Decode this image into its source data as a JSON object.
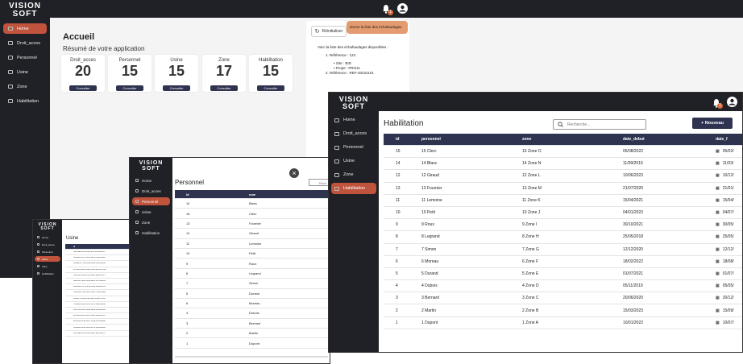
{
  "logo": {
    "line1": "VISION",
    "line2": "SOFT"
  },
  "nav": [
    "Home",
    "Droit_acces",
    "Personnel",
    "Usine",
    "Zone",
    "Habilitation"
  ],
  "accueil": {
    "title": "Accueil",
    "subtitle": "Résumé de votre application",
    "cards": [
      {
        "label": "Droit_acces",
        "value": "20",
        "button": "Consulter"
      },
      {
        "label": "Personnel",
        "value": "15",
        "button": "Consulter"
      },
      {
        "label": "Usine",
        "value": "15",
        "button": "Consulter"
      },
      {
        "label": "Zone",
        "value": "17",
        "button": "Consulter"
      },
      {
        "label": "Habilitation",
        "value": "15",
        "button": "Consulter"
      }
    ],
    "notif_count": "1",
    "reset_label": "Réinitialiser",
    "chip_label": "donne la liste des échafaudages",
    "reply_intro": "Voici la liste des échafaudages disponibles :",
    "reply_item1": "1. Référence : 123",
    "reply_site": "• Site : BID",
    "reply_projet": "• Projet : PROJ1",
    "reply_item2": "2. Référence : REF-20231101"
  },
  "habilitation": {
    "title": "Habilitation",
    "search_placeholder": "Recherche...",
    "new_button": "+ Nouveau",
    "notif_count": "1",
    "columns": [
      "id",
      "personnel",
      "zone",
      "date_debut",
      "date_f"
    ],
    "rows": [
      [
        "15",
        "15 Clerc",
        "15 Zone O",
        "05/08/2022",
        "05/02/"
      ],
      [
        "14",
        "14 Blanc",
        "14 Zone N",
        "11/09/2019",
        "11/03/"
      ],
      [
        "12",
        "12 Giraud",
        "12 Zone L",
        "10/06/2023",
        "10/12/"
      ],
      [
        "13",
        "13 Fournier",
        "13 Zone M",
        "21/07/2020",
        "21/01/"
      ],
      [
        "11",
        "11 Lemoine",
        "11 Zone K",
        "15/04/2021",
        "15/04/"
      ],
      [
        "10",
        "10 Petit",
        "10 Zone J",
        "04/01/2023",
        "04/07/"
      ],
      [
        "9",
        "9 Roux",
        "9 Zone I",
        "30/10/2021",
        "30/05/"
      ],
      [
        "8",
        "8 Legrand",
        "8 Zone H",
        "25/05/2018",
        "25/05/"
      ],
      [
        "7",
        "7 Simon",
        "7 Zone G",
        "12/12/2020",
        "12/12/"
      ],
      [
        "6",
        "6 Moreau",
        "6 Zone F",
        "18/02/2022",
        "18/08/"
      ],
      [
        "5",
        "5 Durand",
        "5 Zone E",
        "01/07/2021",
        "01/07/"
      ],
      [
        "4",
        "4 Dubois",
        "4 Zone D",
        "05/11/2019",
        "05/05/"
      ],
      [
        "3",
        "3 Bernard",
        "3 Zone C",
        "20/06/2020",
        "20/12/"
      ],
      [
        "2",
        "2 Martin",
        "2 Zone B",
        "15/03/2023",
        "15/09/"
      ],
      [
        "1",
        "1 Dupont",
        "1 Zone A",
        "10/01/2022",
        "10/07/"
      ]
    ]
  },
  "personnel": {
    "title": "Personnel",
    "search_placeholder": "Rech",
    "close_symbol": "×",
    "columns": [
      "id",
      "nom"
    ],
    "rows": [
      [
        "14",
        "Blanc"
      ],
      [
        "15",
        "Clerc"
      ],
      [
        "13",
        "Fournier"
      ],
      [
        "12",
        "Giraud"
      ],
      [
        "11",
        "Lemoine"
      ],
      [
        "10",
        "Petit"
      ],
      [
        "9",
        "Roux"
      ],
      [
        "8",
        "Legrand"
      ],
      [
        "7",
        "Simon"
      ],
      [
        "5",
        "Durand"
      ],
      [
        "6",
        "Moreau"
      ],
      [
        "4",
        "Dubois"
      ],
      [
        "3",
        "Bernard"
      ],
      [
        "2",
        "Martin"
      ],
      [
        "1",
        "Dupont"
      ]
    ]
  },
  "usine": {
    "title": "Usine",
    "columns": [
      "id"
    ],
    "rows": [
      [
        "5ed1f2a8-8c11-4a1e-9b7f-2c0d3ea1b7"
      ],
      [
        "1e8f9d02-3b7c-4e55-a09f-7c6d12b9e0"
      ],
      [
        "9c4a6e13-70bd-4f2a-8d1e-5b3f08c2a6"
      ],
      [
        "2d7e0b95-a6c3-4d81-9f40-e1b56c7d83"
      ],
      [
        "b3f81c4e-5d29-47a0-8e6b-0a9c2f1d74"
      ],
      [
        "6a0c5d37-e8f4-4b92-a1d5-3c7e9b08f2"
      ],
      [
        "e4b92a61-0f7d-4c38-b5e2-8d1a6f3c09"
      ],
      [
        "3f6d8b20-c1e5-4a97-9d03-7b2e5c4a18"
      ],
      [
        "8c2e4f79-6b0a-41d3-a8f5-2e9d7c1b60"
      ],
      [
        "7b1a3e58-d4c2-4f06-9e71-5a8b3d0c2f"
      ],
      [
        "0d5c7a92-3e1f-48b4-a6d9-c2f0e8b5a3"
      ],
      [
        "4e9f1b06-a7d3-4c85-b2e0-9f6a3d7c14"
      ],
      [
        "a1d6c385-2f9e-4b07-8c4a-e5b1f0d9a2"
      ],
      [
        "c8e3a0f4-9b5d-42e1-a7c6-1d4f8e2b90"
      ],
      [
        "f2b7d9a1-4c8e-4d36-9a05-6e3c1b8f7d"
      ]
    ]
  }
}
